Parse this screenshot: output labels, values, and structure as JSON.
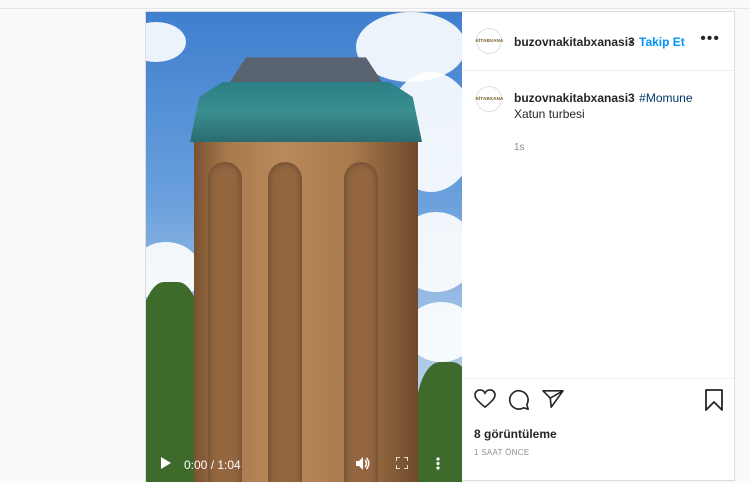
{
  "post": {
    "username": "buzovnakitabxanasi3",
    "separator": "•",
    "follow_label": "Takip Et",
    "more_label": "•••",
    "avatar_text": "KİTABXANA",
    "caption": {
      "username": "buzovnakitabxanasi3",
      "hashtag": "#Momune",
      "text": "Xatun turbesi",
      "time": "1s"
    },
    "views_text": "8 görüntüleme",
    "posted_time": "1 SAAT ÖNCE"
  },
  "video": {
    "time_display": "0:00 / 1:04",
    "play_icon": "play-icon",
    "volume_icon": "volume-icon",
    "fullscreen_icon": "fullscreen-icon",
    "options_icon": "more-vertical-icon"
  },
  "colors": {
    "accent": "#0095f6",
    "hashtag": "#00376b",
    "text": "#262626",
    "muted": "#8e8e8e"
  }
}
